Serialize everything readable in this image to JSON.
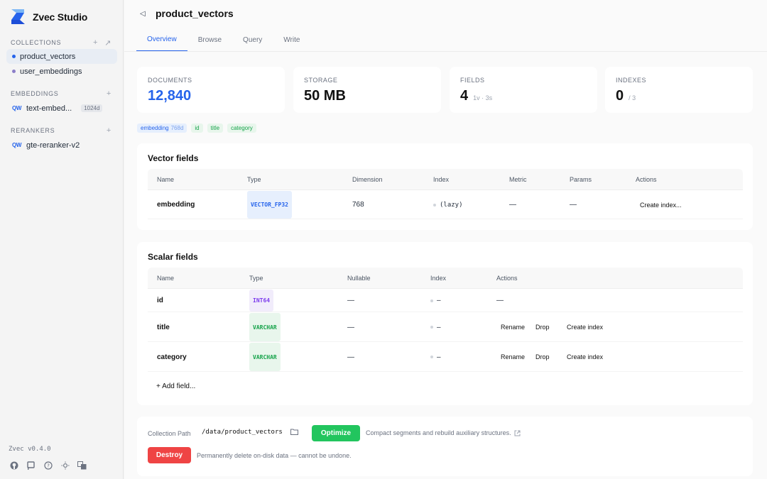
{
  "app": {
    "name": "Zvec Studio",
    "version": "Zvec v0.4.0",
    "accent": "#2563eb"
  },
  "sidebar": {
    "collections": {
      "header": "COLLECTIONS",
      "items": [
        {
          "label": "product_vectors",
          "active": true,
          "dot_color": "#2563eb"
        },
        {
          "label": "user_embeddings",
          "active": false,
          "dot_color": "#8b7ec8"
        }
      ]
    },
    "embeddings": {
      "header": "EMBEDDINGS",
      "items": [
        {
          "provider": "QW",
          "label": "text-embed...",
          "badge": "1024d"
        }
      ]
    },
    "rerankers": {
      "header": "RERANKERS",
      "items": [
        {
          "provider": "QW",
          "label": "gte-reranker-v2"
        }
      ]
    },
    "footer_icons": [
      "github-icon",
      "flag-icon",
      "help-icon",
      "theme-icon",
      "language-icon"
    ]
  },
  "header": {
    "title": "product_vectors"
  },
  "tabs": [
    {
      "label": "Overview",
      "active": true
    },
    {
      "label": "Browse",
      "active": false
    },
    {
      "label": "Query",
      "active": false
    },
    {
      "label": "Write",
      "active": false
    }
  ],
  "stats": [
    {
      "label": "DOCUMENTS",
      "value": "12,840",
      "sub": ""
    },
    {
      "label": "STORAGE",
      "value": "50 MB",
      "sub": ""
    },
    {
      "label": "FIELDS",
      "value": "4",
      "sub": "1v · 3s"
    },
    {
      "label": "INDEXES",
      "value": "0",
      "sub": "/ 3"
    }
  ],
  "field_chips": [
    {
      "label": "embedding",
      "sub": "768d",
      "color": "blue"
    },
    {
      "label": "id",
      "color": "green"
    },
    {
      "label": "title",
      "color": "green"
    },
    {
      "label": "category",
      "color": "green"
    }
  ],
  "vector_fields": {
    "title": "Vector fields",
    "columns": [
      "Name",
      "Type",
      "Dimension",
      "Index",
      "Metric",
      "Params",
      "Actions"
    ],
    "rows": [
      {
        "name": "embedding",
        "type": "VECTOR_FP32",
        "dimension": "768",
        "index": "(lazy)",
        "metric": "—",
        "params": "—",
        "action": "Create index..."
      }
    ]
  },
  "scalar_fields": {
    "title": "Scalar fields",
    "columns": [
      "Name",
      "Type",
      "Nullable",
      "Index",
      "Actions"
    ],
    "rows": [
      {
        "name": "id",
        "type": "INT64",
        "nullable": "—",
        "index": "–",
        "action_text": "—"
      },
      {
        "name": "title",
        "type": "VARCHAR",
        "nullable": "—",
        "index": "–",
        "actions": [
          "Rename",
          "Drop",
          "Create index"
        ]
      },
      {
        "name": "category",
        "type": "VARCHAR",
        "nullable": "—",
        "index": "–",
        "actions": [
          "Rename",
          "Drop",
          "Create index"
        ]
      }
    ],
    "add_label": "+ Add field..."
  },
  "maintenance": {
    "path_label": "Collection Path",
    "path": "/data/product_vectors",
    "optimize_label": "Optimize",
    "optimize_desc": "Compact segments and rebuild auxiliary structures.",
    "destroy_label": "Destroy",
    "destroy_desc": "Permanently delete on-disk data — cannot be undone."
  }
}
